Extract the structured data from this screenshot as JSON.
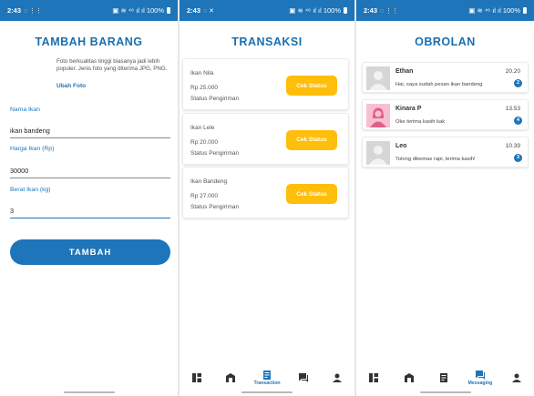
{
  "colors": {
    "primary": "#1e75b9",
    "accent": "#ffbe0b",
    "status_bar": "#1e75b9"
  },
  "status_bar": {
    "time": "2:43",
    "battery": "100%"
  },
  "tambah": {
    "title": "TAMBAH BARANG",
    "photo_note": "Foto berkualitas tinggi biasanya jadi lebih populer. Jenis foto yang diterima JPG, PNG.",
    "photo_link": "Ubah Foto",
    "fields": [
      {
        "label": "Nama Ikan",
        "value": "ikan bandeng"
      },
      {
        "label": "Harga Ikan (Rp)",
        "value": "30000"
      },
      {
        "label": "Berat Ikan (kg)",
        "value": "3"
      }
    ],
    "submit": "TAMBAH"
  },
  "transaksi": {
    "title": "TRANSAKSI",
    "items": [
      {
        "name": "Ikan Nila",
        "price": "Rp 25.000",
        "status": "Status Pengiriman",
        "button": "Cek Status"
      },
      {
        "name": "Ikan Lele",
        "price": "Rp 20.000",
        "status": "Status Pengiriman",
        "button": "Cek Status"
      },
      {
        "name": "Ikan Bandeng",
        "price": "Rp 27.000",
        "status": "Status Pengiriman",
        "button": "Cek Status"
      }
    ],
    "nav_active_label": "Transaction"
  },
  "obrolan": {
    "title": "OBROLAN",
    "chats": [
      {
        "name": "Ethan",
        "message": "Hai, saya sudah pesan ikan bandeng",
        "time": "20.20",
        "unread": "2",
        "avatar": "default-avatar"
      },
      {
        "name": "Kinara P",
        "message": "Oke terima kasih kak",
        "time": "13.53",
        "unread": "4",
        "avatar": "female-avatar"
      },
      {
        "name": "Leo",
        "message": "Tolong dikemas rapi, terima kasih!",
        "time": "10.39",
        "unread": "3",
        "avatar": "default-avatar"
      }
    ],
    "nav_active_label": "Messaging"
  },
  "nav_icons": [
    "dashboard-icon",
    "store-icon",
    "transaction-icon",
    "messaging-icon",
    "profile-icon"
  ]
}
